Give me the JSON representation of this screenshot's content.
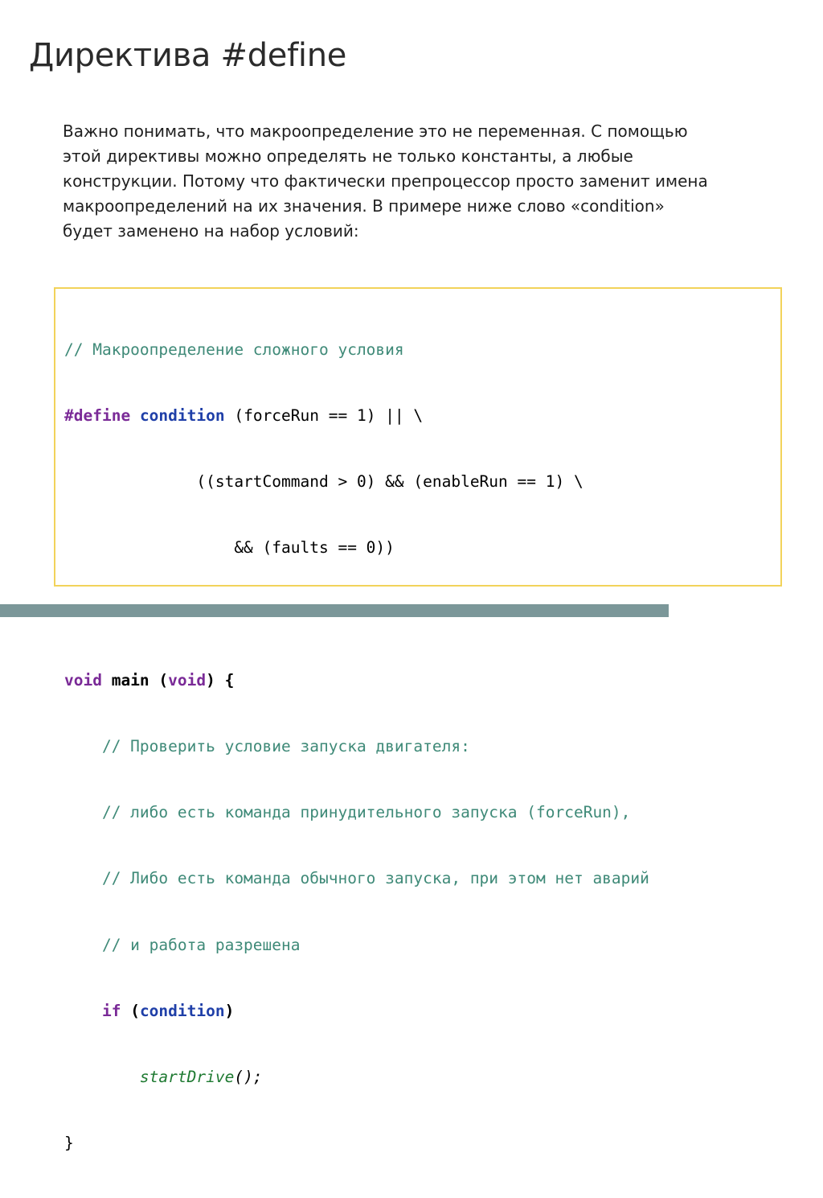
{
  "slide": {
    "title": "Директива #define",
    "paragraph_lines": [
      "Важно понимать, что макроопределение это не переменная. С помощью",
      "этой директивы можно определять не только константы, а любые",
      "конструкции. Потому что фактически препроцессор просто заменит имена",
      "макроопределений на их значения. В примере ниже слово «condition»",
      "будет заменено на набор условий:"
    ],
    "code": {
      "comment_macro": "// Макроопределение сложного условия",
      "define_kw": "#define",
      "macro_name": "condition",
      "define_rest": " (forceRun == 1) || \\",
      "cont_line_1": "              ((startCommand > 0) && (enableRun == 1) \\",
      "cont_line_2": "                  && (faults == 0))",
      "void_kw": "void",
      "main_sig": " main (",
      "void_kw_2": "void",
      "main_close": ") {",
      "comment_1": "    // Проверить условие запуска двигателя:",
      "comment_2": "    // либо есть команда принудительного запуска (forceRun),",
      "comment_3": "    // Либо есть команда обычного запуска, при этом нет аварий",
      "comment_4": "    // и работа разрешена",
      "if_indent": "    ",
      "if_kw": "if",
      "if_open": " (",
      "if_cond": "condition",
      "if_close": ")",
      "call_indent": "        ",
      "call_fn": "startDrive",
      "call_args": "();",
      "closing_brace": "}"
    }
  },
  "colors": {
    "code_border": "#f2d35a",
    "comment": "#3f8a78",
    "keyword": "#7a2a97",
    "macro": "#1f3fa8",
    "function": "#1f7a32",
    "bottom_bar": "#7b9799"
  }
}
